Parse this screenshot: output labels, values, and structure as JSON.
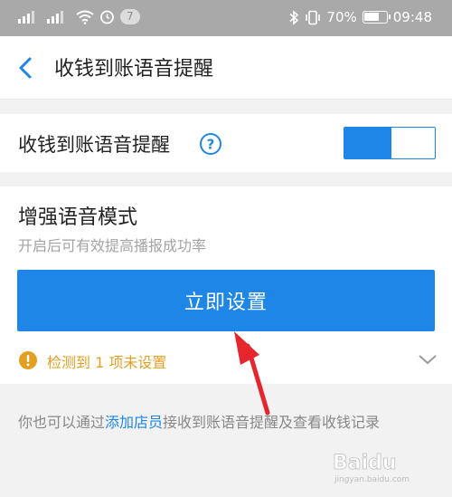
{
  "status_bar": {
    "notification_count": "7",
    "battery": "70%",
    "time": "09:48"
  },
  "nav": {
    "title": "收钱到账语音提醒"
  },
  "voice_toggle": {
    "label": "收钱到账语音提醒",
    "enabled": true
  },
  "enhance": {
    "title": "增强语音模式",
    "subtitle": "开启后可有效提高播报成功率",
    "button_label": "立即设置",
    "warning_text": "检测到 1 项未设置"
  },
  "footer": {
    "prefix": "你也可以通过",
    "link": "添加店员",
    "suffix": "接收到账语音提醒及查看收钱记录"
  },
  "watermark": {
    "brand": "Baidu",
    "sub": "jingyan.baidu.com"
  },
  "colors": {
    "accent": "#1e86e6",
    "warning": "#e39f22",
    "arrow": "#e5262d"
  }
}
